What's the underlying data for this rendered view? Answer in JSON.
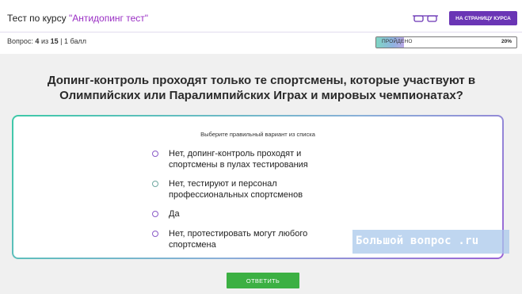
{
  "header": {
    "course_prefix": "Тест по курсу",
    "course_name": "\"Антидопинг тест\"",
    "to_course_label": "НА СТРАНИЦУ КУРСА",
    "accent_color": "#6a35b5"
  },
  "status": {
    "question_label": "Вопрос:",
    "current": "4",
    "of_label": "из",
    "total": "15",
    "points": "| 1 балл",
    "progress_label": "ПРОЙДЕНО",
    "progress_percent_text": "20%",
    "progress_fraction": 0.2
  },
  "question": {
    "text": "Допинг-контроль проходят только те спортсмены, которые участвуют в Олимпийских или Паралимпийских Играх и мировых чемпионатах?"
  },
  "answers": {
    "instruction": "Выберите правильный вариант из списка",
    "options": [
      {
        "label": "Нет, допинг-контроль проходят и спортсмены в пулах тестирования"
      },
      {
        "label": "Нет, тестируют и персонал профессиональных спортсменов"
      },
      {
        "label": "Да"
      },
      {
        "label": "Нет, протестировать могут любого спортсмена"
      }
    ]
  },
  "watermark": {
    "text": "Большой вопрос .ru"
  },
  "submit": {
    "label": "ОТВЕТИТЬ",
    "color": "#3cb043"
  },
  "icons": {
    "glasses": "glasses-icon"
  }
}
